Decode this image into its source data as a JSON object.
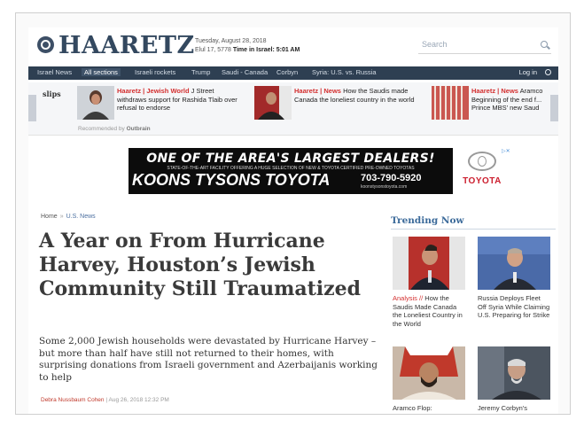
{
  "header": {
    "logo": "HAARETZ",
    "date_line1": "Tuesday, August 28, 2018",
    "date_line2_prefix": "Elul 17, 5778",
    "date_line2_time": "Time in Israel: 5:01 AM",
    "search_placeholder": "Search"
  },
  "nav": {
    "items": [
      "Israel News",
      "All sections",
      "Israeli rockets",
      "Trump",
      "Saudi - Canada",
      "Corbyn",
      "Syria: U.S. vs. Russia"
    ],
    "login": "Log in"
  },
  "recommended": {
    "label": "slips",
    "items": [
      {
        "kicker": "Haaretz | Jewish World",
        "text": "J Street withdraws support for Rashida Tlaib over refusal to endorse"
      },
      {
        "kicker": "Haaretz | News",
        "text": "How the Saudis made Canada the loneliest country in the world"
      },
      {
        "kicker": "Haaretz | News",
        "text": "Aramco Beginning of the end f... Prince MBS' new Saud"
      }
    ],
    "attribution_prefix": "Recommended by",
    "attribution_brand": "Outbrain"
  },
  "ad": {
    "line1": "ONE OF THE AREA'S LARGEST DEALERS!",
    "line2": "STATE-OF-THE-ART FACILITY OFFERING A HUGE SELECTION OF NEW & TOYOTA CERTIFIED PRE-OWNED TOYOTAS",
    "line3": "KOONS TYSONS TOYOTA",
    "phone": "703-790-5920",
    "url": "koonstysonstoyota.com",
    "brand": "TOYOTA"
  },
  "article": {
    "breadcrumb_home": "Home",
    "breadcrumb_sep": "»",
    "breadcrumb_section": "U.S. News",
    "headline": "A Year on From Hurricane Harvey, Houston’s Jewish Community Still Traumatized",
    "dek": "Some 2,000 Jewish households were devastated by Hurricane Harvey – but more than half have still not returned to their homes, with surprising donations from Israeli government and Azerbaijanis working to help",
    "author": "Debra Nussbaum Cohen",
    "date": "Aug 26, 2018 12:32 PM"
  },
  "trending": {
    "title": "Trending Now",
    "items": [
      {
        "kicker": "Analysis //",
        "text": "How the Saudis Made Canada the Loneliest Country in the World"
      },
      {
        "kicker": "",
        "text": "Russia Deploys Fleet Off Syria While Claiming U.S. Preparing for Strike"
      },
      {
        "kicker": "",
        "text": "Aramco Flop:"
      },
      {
        "kicker": "",
        "text": "Jeremy Corbyn's"
      }
    ]
  },
  "colors": {
    "nav_bg": "#2e3f52",
    "logo": "#33485f",
    "kicker_red": "#d32f2f",
    "trending_blue": "#3b6a9a"
  }
}
